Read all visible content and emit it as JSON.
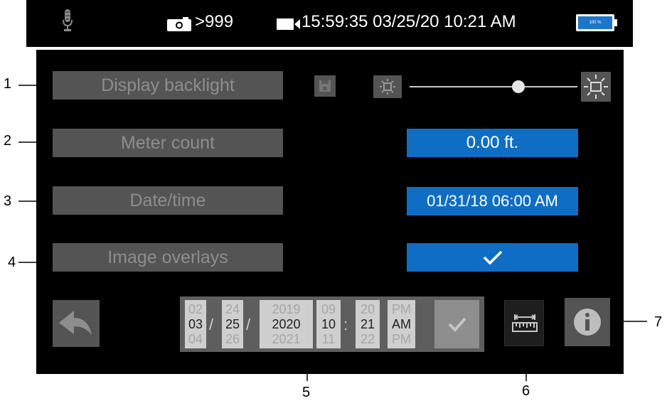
{
  "status_bar": {
    "photo_count": ">999",
    "timecode": "15:59:35 03/25/20 10:21 AM",
    "battery_percent": "100 %",
    "icons": [
      "microphone-icon",
      "camera-icon",
      "video-camera-icon",
      "battery-icon"
    ]
  },
  "settings": {
    "rows": [
      {
        "label": "Display backlight"
      },
      {
        "label": "Meter count",
        "value": "0.00 ft."
      },
      {
        "label": "Date/time",
        "value": "01/31/18 06:00 AM"
      },
      {
        "label": "Image overlays",
        "value_icon": "checkmark-icon"
      }
    ],
    "backlight_level": 0.65
  },
  "date_picker": {
    "month": [
      "02",
      "03",
      "04"
    ],
    "day": [
      "24",
      "25",
      "26"
    ],
    "year": [
      "2019",
      "2020",
      "2021"
    ],
    "hour": [
      "09",
      "10",
      "11"
    ],
    "minute": [
      "20",
      "21",
      "22"
    ],
    "ampm": [
      "PM",
      "AM",
      "PM"
    ],
    "date_sep": "/",
    "time_sep": ":"
  },
  "callouts": [
    "1",
    "2",
    "3",
    "4",
    "5",
    "6",
    "7"
  ],
  "colors": {
    "screen_bg": "#000000",
    "label_button_bg": "#545454",
    "label_text": "#8d8d8d",
    "value_accent": "#0f6ec4",
    "picker_bg": "#cfcfcf"
  }
}
